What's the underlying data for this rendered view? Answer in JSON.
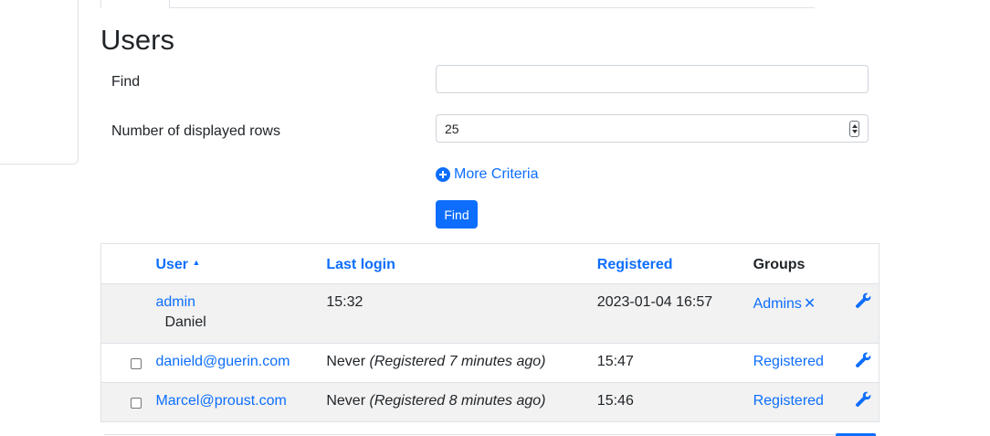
{
  "page": {
    "title": "Users"
  },
  "form": {
    "find_label": "Find",
    "find_value": "",
    "rows_label": "Number of displayed rows",
    "rows_value": "25",
    "more_criteria": "More Criteria",
    "find_button": "Find"
  },
  "table": {
    "headers": {
      "user": "User",
      "last_login": "Last login",
      "registered": "Registered",
      "groups": "Groups"
    },
    "sort_indicator": "▲",
    "rows": [
      {
        "user": "admin",
        "name": "Daniel",
        "last_login": "15:32",
        "last_login_note": "",
        "registered": "2023-01-04 16:57",
        "group": "Admins",
        "remove": "✕"
      },
      {
        "user": "danield@guerin.com",
        "name": "",
        "last_login": "Never",
        "last_login_note": "(Registered 7 minutes ago)",
        "registered": "15:47",
        "group": "Registered",
        "remove": ""
      },
      {
        "user": "Marcel@proust.com",
        "name": "",
        "last_login": "Never",
        "last_login_note": "(Registered 8 minutes ago)",
        "registered": "15:46",
        "group": "Registered",
        "remove": ""
      }
    ]
  },
  "colors": {
    "accent": "#0d6efd",
    "row_alt": "#f2f2f2",
    "border": "#dee2e6"
  },
  "icons": {
    "more_criteria": "plus-circle-icon",
    "actions": "wrench-icon",
    "sort": "caret-up-icon"
  }
}
